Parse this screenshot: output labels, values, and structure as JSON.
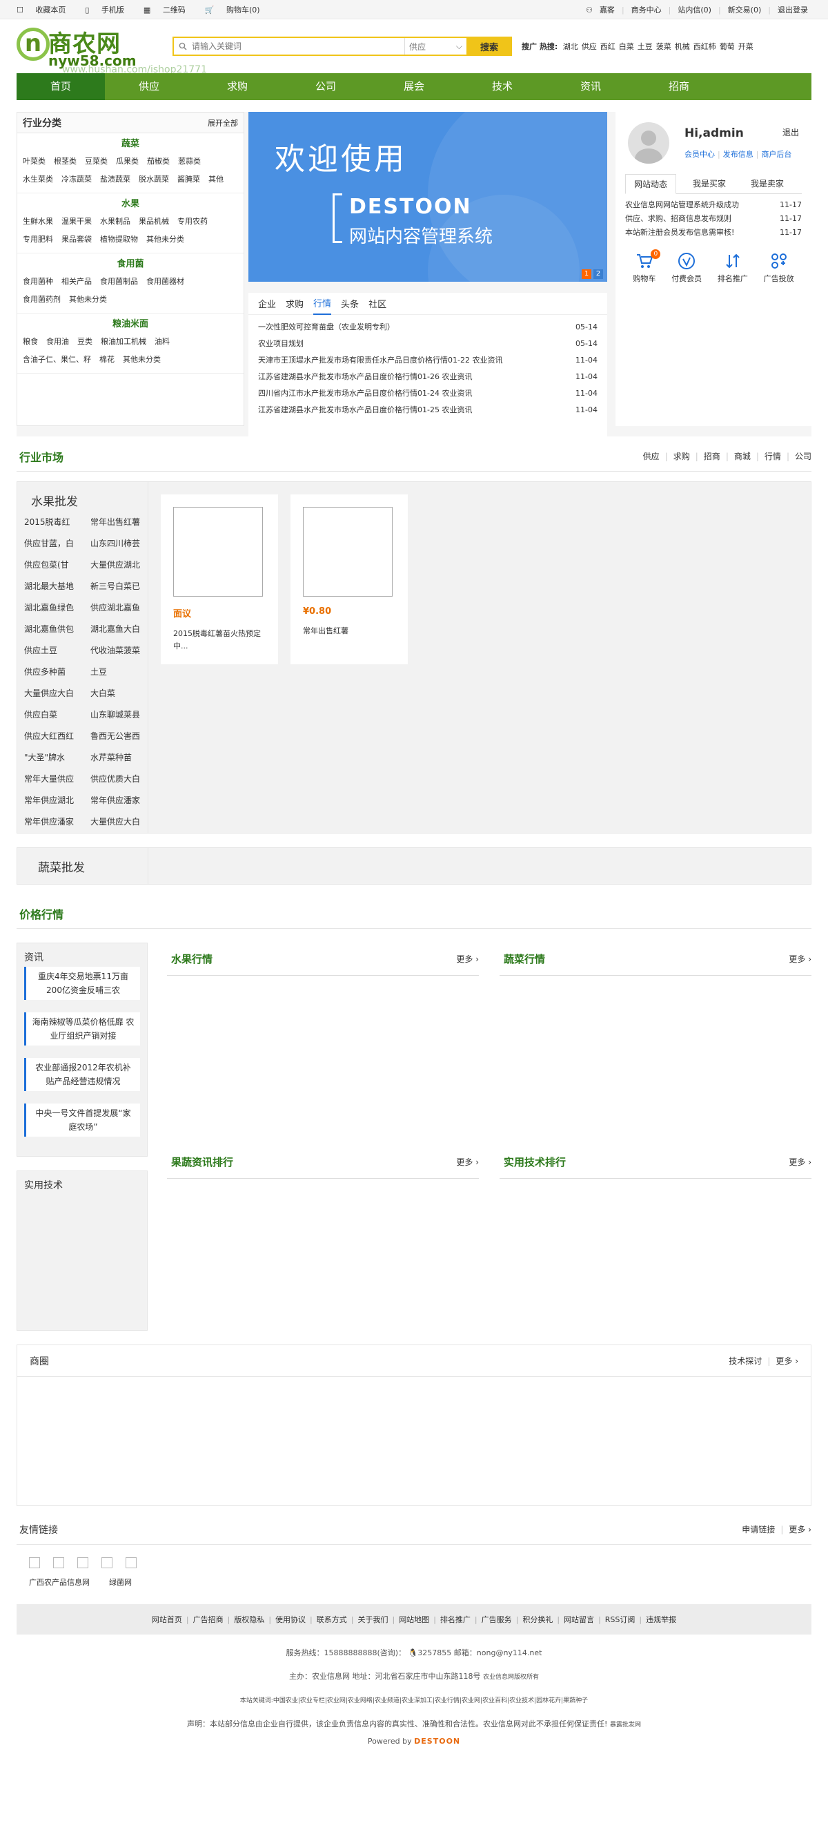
{
  "topbar": {
    "left": [
      "收藏本页",
      "手机版",
      "二维码",
      "购物车(0)"
    ],
    "right": [
      "嘉客",
      "商务中心",
      "站内信(0)",
      "新交易(0)",
      "退出登录"
    ]
  },
  "header": {
    "logo_text": "商农网",
    "logo_domain": "nyw58.com",
    "watermark": "www.hushan.com/ishop21771",
    "search_placeholder": "请输入关键词",
    "search_type": "供应",
    "search_button": "搜索",
    "hot_label": "搜广 热搜:",
    "hot_words": [
      "湖北",
      "供应",
      "西红",
      "白菜",
      "土豆",
      "菠菜",
      "机械",
      "西红柿",
      "葡萄",
      "开菜"
    ]
  },
  "nav": [
    "首页",
    "供应",
    "求购",
    "公司",
    "展会",
    "技术",
    "资讯",
    "招商"
  ],
  "categories": {
    "title": "行业分类",
    "expand": "展开全部",
    "groups": [
      {
        "name": "蔬菜",
        "items": [
          "叶菜类",
          "根茎类",
          "豆菜类",
          "瓜果类",
          "茄椒类",
          "葱蒜类",
          "水生菜类",
          "冷冻蔬菜",
          "盐渍蔬菜",
          "脱水蔬菜",
          "酱腌菜",
          "其他"
        ]
      },
      {
        "name": "水果",
        "items": [
          "生鲜水果",
          "温果干果",
          "水果制品",
          "果品机械",
          "专用农药",
          "专用肥料",
          "果品套袋",
          "植物提取物",
          "其他未分类"
        ]
      },
      {
        "name": "食用菌",
        "items": [
          "食用菌种",
          "相关产品",
          "食用菌制品",
          "食用菌器材",
          "食用菌药剂",
          "其他未分类"
        ]
      },
      {
        "name": "粮油米面",
        "items": [
          "粮食",
          "食用油",
          "豆类",
          "粮油加工机械",
          "油料",
          "含油子仁、果仁、籽",
          "棉花",
          "其他未分类"
        ]
      }
    ]
  },
  "banner": {
    "welcome": "欢迎使用",
    "brand": "DESTOON",
    "subtitle": "网站内容管理系统",
    "pages": [
      "1",
      "2"
    ]
  },
  "news": {
    "tabs": [
      "企业",
      "求购",
      "行情",
      "头条",
      "社区"
    ],
    "active_tab": "行情",
    "items": [
      {
        "title": "一次性肥效可控育苗盘（农业发明专利）",
        "date": "05-14"
      },
      {
        "title": "农业项目规划",
        "date": "05-14"
      },
      {
        "title": "天津市王顶堤水产批发市场有限责任水产品日度价格行情01-22 农业资讯",
        "date": "11-04"
      },
      {
        "title": "江苏省建湖县水产批发市场水产品日度价格行情01-26 农业资讯",
        "date": "11-04"
      },
      {
        "title": "四川省内江市水产批发市场水产品日度价格行情01-24 农业资讯",
        "date": "11-04"
      },
      {
        "title": "江苏省建湖县水产批发市场水产品日度价格行情01-25 农业资讯",
        "date": "11-04"
      }
    ]
  },
  "user": {
    "greeting": "Hi,admin",
    "logout": "退出",
    "links": [
      "会员中心",
      "发布信息",
      "商户后台"
    ],
    "tabs": [
      "网站动态",
      "我是买家",
      "我是卖家"
    ],
    "news": [
      {
        "title": "农业信息网网站管理系统升级成功",
        "date": "11-17"
      },
      {
        "title": "供应、求购、招商信息发布规则",
        "date": "11-17"
      },
      {
        "title": "本站新注册会员发布信息需审核!",
        "date": "11-17"
      }
    ],
    "quick": [
      {
        "label": "购物车",
        "icon": "cart-icon",
        "badge": "0"
      },
      {
        "label": "付费会员",
        "icon": "vip-icon"
      },
      {
        "label": "排名推广",
        "icon": "rank-icon"
      },
      {
        "label": "广告投放",
        "icon": "ad-icon"
      }
    ]
  },
  "market": {
    "title": "行业市场",
    "links": [
      "供应",
      "求购",
      "招商",
      "商城",
      "行情",
      "公司"
    ],
    "fruit": {
      "title": "水果批发",
      "items": [
        "2015脱毒红",
        "常年出售红薯",
        "供应甘蓝，白",
        "山东四川柿芸",
        "供应包菜(甘",
        "大量供应湖北",
        "湖北最大基地",
        "新三号白菜已",
        "湖北嘉鱼绿色",
        "供应湖北嘉鱼",
        "湖北嘉鱼供包",
        "湖北嘉鱼大白",
        "供应土豆",
        "代收油菜菠菜",
        "供应多种菌",
        "土豆",
        "大量供应大白",
        "大白菜",
        "供应白菜",
        "山东聊城莱县",
        "供应大红西红",
        "鲁西无公害西",
        "\"大圣\"牌水",
        "水芹菜种苗",
        "常年大量供应",
        "供应优质大白",
        "常年供应湖北",
        "常年供应潘家",
        "常年供应潘家",
        "大量供应大白"
      ],
      "products": [
        {
          "price": "面议",
          "name": "2015脱毒红薯苗火热预定中..."
        },
        {
          "price": "¥0.80",
          "name": "常年出售红薯"
        }
      ]
    },
    "veg_title": "蔬菜批发"
  },
  "price": {
    "title": "价格行情",
    "left1_title": "资讯",
    "left1_items": [
      "重庆4年交易地票11万亩 200亿资金反哺三农",
      "海南辣椒等瓜菜价格低靡 农业厅组织产销对接",
      "农业部通报2012年农机补贴产品经营违规情况",
      "中央一号文件首提发展“家庭农场”"
    ],
    "left2_title": "实用技术",
    "cols": [
      {
        "title": "水果行情",
        "more": "更多"
      },
      {
        "title": "蔬菜行情",
        "more": "更多"
      },
      {
        "title": "果蔬资讯排行",
        "more": "更多"
      },
      {
        "title": "实用技术排行",
        "more": "更多"
      }
    ]
  },
  "shangquan": {
    "title": "商圈",
    "links": [
      "技术探讨",
      "更多"
    ]
  },
  "friend_links": {
    "title": "友情链接",
    "links": [
      "申请链接",
      "更多"
    ],
    "text": [
      "广西农产品信息网",
      "绿菌网"
    ]
  },
  "footer": {
    "nav": [
      "网站首页",
      "广告招商",
      "版权隐私",
      "使用协议",
      "联系方式",
      "关于我们",
      "网站地图",
      "排名推广",
      "广告服务",
      "积分换礼",
      "网站留言",
      "RSS订阅",
      "违规举报"
    ],
    "hotline": "服务热线：15888888888(咨询)：",
    "qq": "3257855",
    "email": "邮箱：nong@ny114.net",
    "host": "主办：农业信息网 地址：河北省石家庄市中山东路118号",
    "host_small": "农业信息网版权所有",
    "keywords": "本站关键词:中国农业|农业专栏|农业网|农业网络|农业频道|农业深加工|农业行情|农业网|农业百科|农业技术|园林花卉|果蔬种子",
    "statement": "声明：本站部分信息由企业自行提供，该企业负责信息内容的真实性、准确性和合法性。农业信息网对此不承担任何保证责任!",
    "statement_small": "暴露批发网",
    "powered": "Powered by",
    "powered_brand": "DESTOON"
  },
  "colors": {
    "green": "#5d9925",
    "dark_green": "#2d7a1c",
    "yellow": "#f0c419",
    "blue": "#1e6fd9",
    "orange": "#ff6600"
  }
}
